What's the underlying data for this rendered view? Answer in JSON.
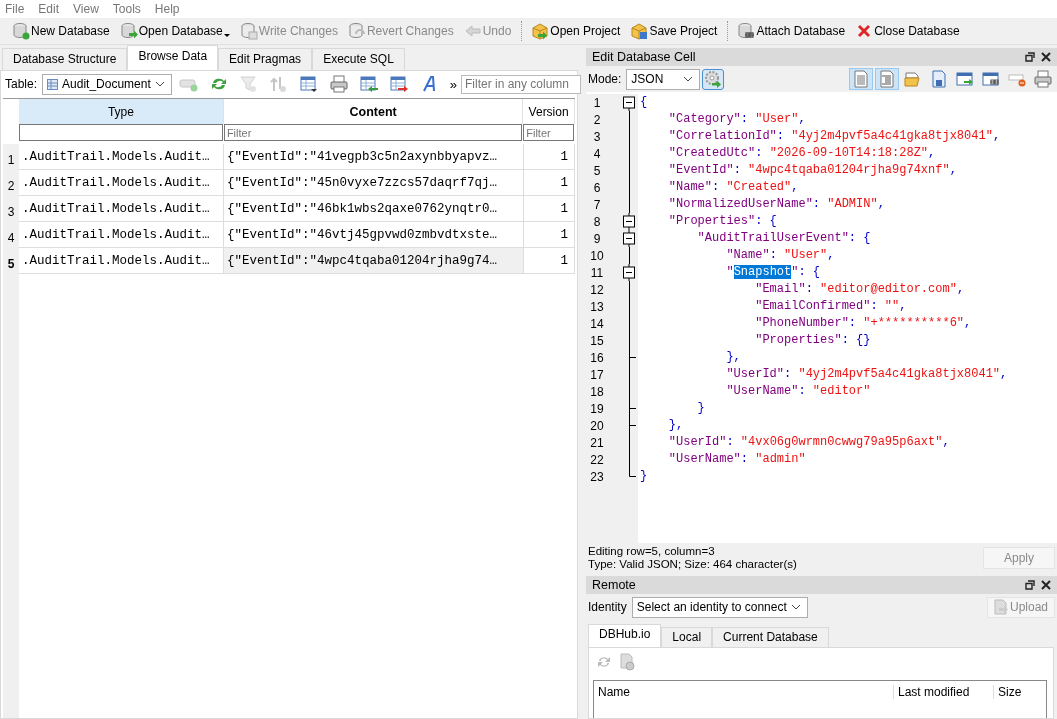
{
  "menu": [
    "File",
    "Edit",
    "View",
    "Tools",
    "Help"
  ],
  "toolbar": [
    {
      "kind": "new-db",
      "label": "New Database",
      "disabled": false,
      "dropdown": false
    },
    {
      "kind": "open-db",
      "label": "Open Database",
      "disabled": false,
      "dropdown": true
    },
    {
      "kind": "write",
      "label": "Write Changes",
      "disabled": true,
      "dropdown": false
    },
    {
      "kind": "revert",
      "label": "Revert Changes",
      "disabled": true,
      "dropdown": false
    },
    {
      "kind": "undo",
      "label": "Undo",
      "disabled": true,
      "dropdown": false
    },
    {
      "kind": "separator"
    },
    {
      "kind": "open-project",
      "label": "Open Project",
      "disabled": false,
      "dropdown": false
    },
    {
      "kind": "save-project",
      "label": "Save Project",
      "disabled": false,
      "dropdown": false
    },
    {
      "kind": "separator"
    },
    {
      "kind": "attach",
      "label": "Attach Database",
      "disabled": false,
      "dropdown": false
    },
    {
      "kind": "close",
      "label": "Close Database",
      "disabled": false,
      "dropdown": false
    }
  ],
  "tabs": [
    {
      "label": "Database Structure",
      "selected": false
    },
    {
      "label": "Browse Data",
      "selected": true
    },
    {
      "label": "Edit Pragmas",
      "selected": false
    },
    {
      "label": "Execute SQL",
      "selected": false
    }
  ],
  "browse": {
    "table_label": "Table:",
    "table": "Audit_Document",
    "more": "»",
    "filter_placeholder": "Filter in any column",
    "tools": [
      {
        "kind": "row-add",
        "disabled": true
      },
      {
        "kind": "refresh",
        "disabled": false
      },
      {
        "kind": "filter",
        "disabled": true
      },
      {
        "kind": "sort",
        "disabled": true
      },
      {
        "kind": "save-table",
        "disabled": false
      },
      {
        "kind": "print",
        "disabled": false
      },
      {
        "kind": "import",
        "disabled": false
      },
      {
        "kind": "export",
        "disabled": false
      },
      {
        "kind": "font",
        "disabled": false
      }
    ]
  },
  "grid": {
    "columns": [
      {
        "label": "Type",
        "selected": true,
        "bold": false
      },
      {
        "label": "Content",
        "selected": false,
        "bold": true,
        "filter_placeholder": "Filter"
      },
      {
        "label": "Version",
        "selected": false,
        "bold": false,
        "filter_placeholder": "Filter"
      }
    ],
    "rows": [
      {
        "number": "1",
        "selected": false,
        "cells": [
          {
            "text": ".AuditTrail.Models.Audit…",
            "current": false
          },
          {
            "text": "{\"EventId\":\"41vegpb3c5n2axynbbyapvz…",
            "current": false
          },
          {
            "text": "1",
            "current": false
          }
        ]
      },
      {
        "number": "2",
        "selected": false,
        "cells": [
          {
            "text": ".AuditTrail.Models.Audit…",
            "current": false
          },
          {
            "text": "{\"EventId\":\"45n0vyxe7zzcs57daqrf7qj…",
            "current": false
          },
          {
            "text": "1",
            "current": false
          }
        ]
      },
      {
        "number": "3",
        "selected": false,
        "cells": [
          {
            "text": ".AuditTrail.Models.Audit…",
            "current": false
          },
          {
            "text": "{\"EventId\":\"46bk1wbs2qaxe0762ynqtr0…",
            "current": false
          },
          {
            "text": "1",
            "current": false
          }
        ]
      },
      {
        "number": "4",
        "selected": false,
        "cells": [
          {
            "text": ".AuditTrail.Models.Audit…",
            "current": false
          },
          {
            "text": "{\"EventId\":\"46vtj45gpvwd0zmbvdtxste…",
            "current": false
          },
          {
            "text": "1",
            "current": false
          }
        ]
      },
      {
        "number": "5",
        "selected": true,
        "cells": [
          {
            "text": ".AuditTrail.Models.Audit…",
            "current": false
          },
          {
            "text": "{\"EventId\":\"4wpc4tqaba01204rjha9g74…",
            "current": true
          },
          {
            "text": "1",
            "current": false
          }
        ]
      }
    ]
  },
  "edit_cell": {
    "title": "Edit Database Cell",
    "mode_label": "Mode:",
    "mode": "JSON",
    "tools": [
      {
        "kind": "text",
        "on": true
      },
      {
        "kind": "indent",
        "on": true
      },
      {
        "kind": "folder",
        "on": false
      },
      {
        "kind": "save",
        "on": false
      },
      {
        "kind": "export",
        "on": false
      },
      {
        "kind": "link",
        "on": false
      },
      {
        "kind": "null",
        "on": false
      },
      {
        "kind": "print",
        "on": false
      }
    ],
    "lines": [
      {
        "number": "1",
        "kind": "open",
        "tokens": [
          {
            "kind": "punct",
            "text": "{"
          }
        ]
      },
      {
        "number": "2",
        "kind": "line",
        "tokens": [
          {
            "kind": "key",
            "text": "    \"Category\""
          },
          {
            "kind": "punct",
            "text": ": "
          },
          {
            "kind": "string",
            "text": "\"User\""
          },
          {
            "kind": "punct",
            "text": ","
          }
        ]
      },
      {
        "number": "3",
        "kind": "line",
        "tokens": [
          {
            "kind": "key",
            "text": "    \"CorrelationId\""
          },
          {
            "kind": "punct",
            "text": ": "
          },
          {
            "kind": "string",
            "text": "\"4yj2m4pvf5a4c41gka8tjx8041\""
          },
          {
            "kind": "punct",
            "text": ","
          }
        ]
      },
      {
        "number": "4",
        "kind": "line",
        "tokens": [
          {
            "kind": "key",
            "text": "    \"CreatedUtc\""
          },
          {
            "kind": "punct",
            "text": ": "
          },
          {
            "kind": "string",
            "text": "\"2026-09-10T14:18:28Z\""
          },
          {
            "kind": "punct",
            "text": ","
          }
        ]
      },
      {
        "number": "5",
        "kind": "line",
        "tokens": [
          {
            "kind": "key",
            "text": "    \"EventId\""
          },
          {
            "kind": "punct",
            "text": ": "
          },
          {
            "kind": "string",
            "text": "\"4wpc4tqaba01204rjha9g74xnf\""
          },
          {
            "kind": "punct",
            "text": ","
          }
        ]
      },
      {
        "number": "6",
        "kind": "line",
        "tokens": [
          {
            "kind": "key",
            "text": "    \"Name\""
          },
          {
            "kind": "punct",
            "text": ": "
          },
          {
            "kind": "string",
            "text": "\"Created\""
          },
          {
            "kind": "punct",
            "text": ","
          }
        ]
      },
      {
        "number": "7",
        "kind": "line",
        "tokens": [
          {
            "kind": "key",
            "text": "    \"NormalizedUserName\""
          },
          {
            "kind": "punct",
            "text": ": "
          },
          {
            "kind": "string",
            "text": "\"ADMIN\""
          },
          {
            "kind": "punct",
            "text": ","
          }
        ]
      },
      {
        "number": "8",
        "kind": "open",
        "tokens": [
          {
            "kind": "key",
            "text": "    \"Properties\""
          },
          {
            "kind": "punct",
            "text": ": {"
          }
        ]
      },
      {
        "number": "9",
        "kind": "open",
        "tokens": [
          {
            "kind": "key",
            "text": "        \"AuditTrailUserEvent\""
          },
          {
            "kind": "punct",
            "text": ": {"
          }
        ]
      },
      {
        "number": "10",
        "kind": "line",
        "tokens": [
          {
            "kind": "key",
            "text": "            \"Name\""
          },
          {
            "kind": "punct",
            "text": ": "
          },
          {
            "kind": "string",
            "text": "\"User\""
          },
          {
            "kind": "punct",
            "text": ","
          }
        ]
      },
      {
        "number": "11",
        "kind": "open",
        "tokens": [
          {
            "kind": "key",
            "text": "            \""
          },
          {
            "kind": "selected",
            "text": "Snapshot"
          },
          {
            "kind": "key",
            "text": "\""
          },
          {
            "kind": "punct",
            "text": ": {"
          }
        ]
      },
      {
        "number": "12",
        "kind": "line",
        "tokens": [
          {
            "kind": "key",
            "text": "                \"Email\""
          },
          {
            "kind": "punct",
            "text": ": "
          },
          {
            "kind": "string",
            "text": "\"editor@editor.com\""
          },
          {
            "kind": "punct",
            "text": ","
          }
        ]
      },
      {
        "number": "13",
        "kind": "line",
        "tokens": [
          {
            "kind": "key",
            "text": "                \"EmailConfirmed\""
          },
          {
            "kind": "punct",
            "text": ": "
          },
          {
            "kind": "string",
            "text": "\"\""
          },
          {
            "kind": "punct",
            "text": ","
          }
        ]
      },
      {
        "number": "14",
        "kind": "line",
        "tokens": [
          {
            "kind": "key",
            "text": "                \"PhoneNumber\""
          },
          {
            "kind": "punct",
            "text": ": "
          },
          {
            "kind": "string",
            "text": "\"+**********6\""
          },
          {
            "kind": "punct",
            "text": ","
          }
        ]
      },
      {
        "number": "15",
        "kind": "line",
        "tokens": [
          {
            "kind": "key",
            "text": "                \"Properties\""
          },
          {
            "kind": "punct",
            "text": ": {}"
          }
        ]
      },
      {
        "number": "16",
        "kind": "tee",
        "tokens": [
          {
            "kind": "punct",
            "text": "            },"
          }
        ]
      },
      {
        "number": "17",
        "kind": "line",
        "tokens": [
          {
            "kind": "key",
            "text": "            \"UserId\""
          },
          {
            "kind": "punct",
            "text": ": "
          },
          {
            "kind": "string",
            "text": "\"4yj2m4pvf5a4c41gka8tjx8041\""
          },
          {
            "kind": "punct",
            "text": ","
          }
        ]
      },
      {
        "number": "18",
        "kind": "line",
        "tokens": [
          {
            "kind": "key",
            "text": "            \"UserName\""
          },
          {
            "kind": "punct",
            "text": ": "
          },
          {
            "kind": "string",
            "text": "\"editor\""
          }
        ]
      },
      {
        "number": "19",
        "kind": "tee",
        "tokens": [
          {
            "kind": "punct",
            "text": "        }"
          }
        ]
      },
      {
        "number": "20",
        "kind": "tee",
        "tokens": [
          {
            "kind": "punct",
            "text": "    },"
          }
        ]
      },
      {
        "number": "21",
        "kind": "line",
        "tokens": [
          {
            "kind": "key",
            "text": "    \"UserId\""
          },
          {
            "kind": "punct",
            "text": ": "
          },
          {
            "kind": "string",
            "text": "\"4vx06g0wrmn0cwwg79a95p6axt\""
          },
          {
            "kind": "punct",
            "text": ","
          }
        ]
      },
      {
        "number": "22",
        "kind": "line",
        "tokens": [
          {
            "kind": "key",
            "text": "    \"UserName\""
          },
          {
            "kind": "punct",
            "text": ": "
          },
          {
            "kind": "string",
            "text": "\"admin\""
          }
        ]
      },
      {
        "number": "23",
        "kind": "end",
        "tokens": [
          {
            "kind": "punct",
            "text": "}"
          }
        ]
      }
    ],
    "status": [
      "Editing row=5, column=3",
      "Type: Valid JSON; Size: 464 character(s)"
    ],
    "apply": {
      "label": "Apply",
      "disabled": true
    }
  },
  "remote": {
    "title": "Remote",
    "identity_label": "Identity",
    "identity": "Select an identity to connect",
    "upload": {
      "label": "Upload",
      "disabled": true
    },
    "tabs": [
      {
        "label": "DBHub.io",
        "selected": true
      },
      {
        "label": "Local",
        "selected": false
      },
      {
        "label": "Current Database",
        "selected": false
      }
    ],
    "columns": [
      "Name",
      "Last modified",
      "Size"
    ]
  }
}
